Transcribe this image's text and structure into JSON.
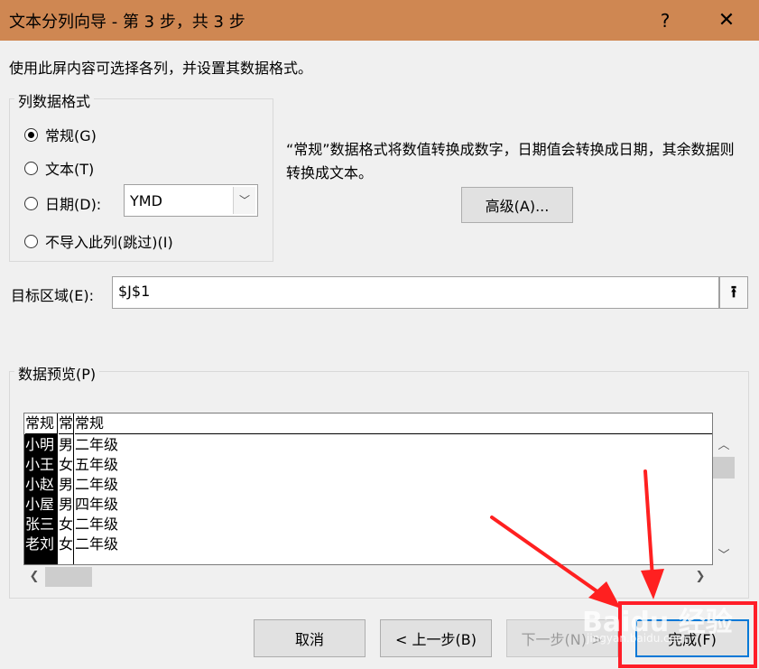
{
  "window": {
    "title": "文本分列向导 - 第 3 步，共 3 步",
    "help_label": "?",
    "close_label": "✕"
  },
  "description": "使用此屏内容可选择各列，并设置其数据格式。",
  "column_format": {
    "group_label": "列数据格式",
    "options": [
      {
        "label": "常规(G)",
        "checked": true
      },
      {
        "label": "文本(T)",
        "checked": false
      },
      {
        "label": "日期(D):",
        "checked": false
      },
      {
        "label": "不导入此列(跳过)(I)",
        "checked": false
      }
    ],
    "date_format_value": "YMD"
  },
  "info_text": "“常规”数据格式将数值转换成数字，日期值会转换成日期，其余数据则转换成文本。",
  "advanced_button": "高级(A)...",
  "target": {
    "label": "目标区域(E):",
    "value": "$J$1"
  },
  "preview": {
    "group_label": "数据预览(P)",
    "headers": [
      "常规",
      "常",
      "常规"
    ],
    "rows": [
      [
        "小明",
        "男",
        "二年级"
      ],
      [
        "小王",
        "女",
        "五年级"
      ],
      [
        "小赵",
        "男",
        "二年级"
      ],
      [
        "小屋",
        "男",
        "四年级"
      ],
      [
        "张三",
        "女",
        "二年级"
      ],
      [
        "老刘",
        "女",
        "二年级"
      ]
    ]
  },
  "buttons": {
    "cancel": "取消",
    "back": "< 上一步(B)",
    "next": "下一步(N) >",
    "finish": "完成(F)"
  },
  "colors": {
    "titlebar": "#cf8752",
    "highlight_box": "#ff1e28",
    "annotation_arrow": "#ff2020"
  }
}
